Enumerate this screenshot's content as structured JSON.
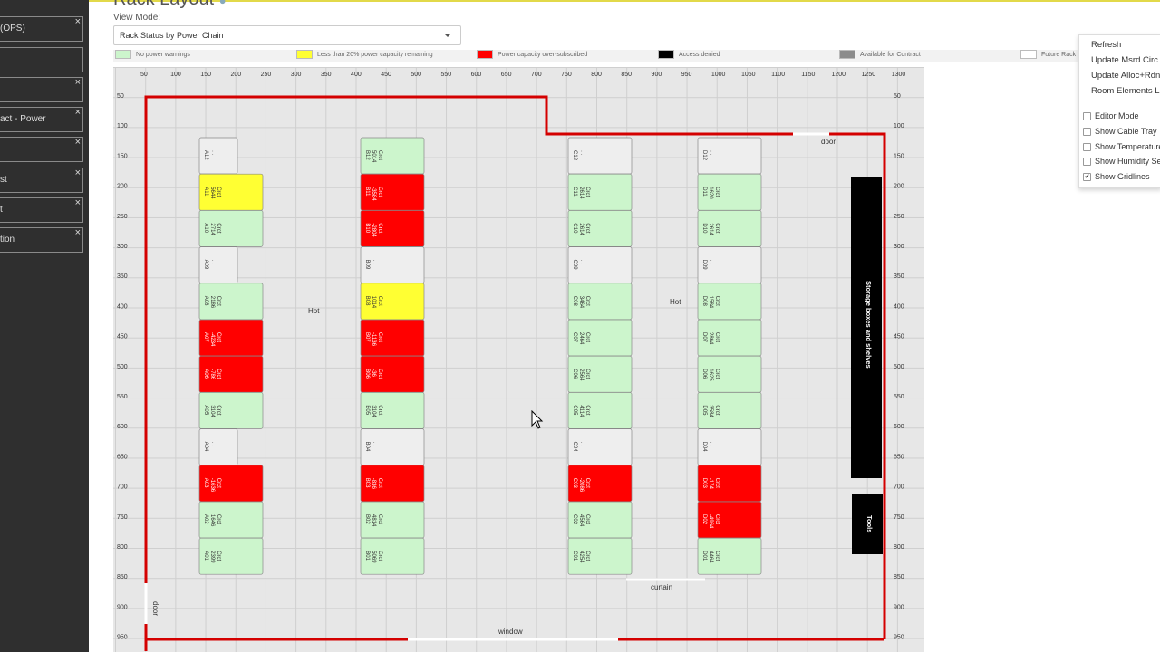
{
  "sidebar": {
    "tabs": [
      {
        "label": "(OPS)",
        "close": "×"
      },
      {
        "label": "",
        "close": ""
      },
      {
        "label": "",
        "close": "×"
      },
      {
        "label": "act - Power",
        "close": "×"
      },
      {
        "label": "",
        "close": "×"
      },
      {
        "label": "st",
        "close": "×"
      },
      {
        "label": "t",
        "close": "×"
      },
      {
        "label": "tion",
        "close": "×"
      }
    ]
  },
  "header": {
    "title": "Rack Layout",
    "view_mode_label": "View Mode:",
    "view_mode_value": "Rack Status by Power Chain"
  },
  "legend": [
    {
      "label": "No power warnings",
      "color": "#ccf5cc"
    },
    {
      "label": "Less than 20% power capacity remaining",
      "color": "#ffff33"
    },
    {
      "label": "Power capacity over-subscribed",
      "color": "#ff0000"
    },
    {
      "label": "Access denied",
      "color": "#000000"
    },
    {
      "label": "Available for Contract",
      "color": "#8c8c8c"
    },
    {
      "label": "Future Rack",
      "color": "#ffffff"
    }
  ],
  "axis": {
    "x_ticks": [
      "50",
      "100",
      "150",
      "200",
      "250",
      "300",
      "350",
      "400",
      "450",
      "500",
      "550",
      "600",
      "650",
      "700",
      "750",
      "800",
      "850",
      "900",
      "950",
      "1000",
      "1050",
      "1100",
      "1150",
      "1200",
      "1250",
      "1300"
    ],
    "y_ticks": [
      "50",
      "100",
      "150",
      "200",
      "250",
      "300",
      "350",
      "400",
      "450",
      "500",
      "550",
      "600",
      "650",
      "700",
      "750",
      "800",
      "850",
      "900",
      "950"
    ]
  },
  "labels": {
    "hot_a": "Hot",
    "hot_b": "Hot",
    "door_top": "door",
    "door_left": "door",
    "curtain": "curtain",
    "window": "window",
    "storage": "Storage boxes and shelves",
    "tools": "Tools"
  },
  "rows": [
    {
      "id": "A",
      "racks": [
        {
          "name": "A12",
          "line1": "",
          "line2": "",
          "status": "empty"
        },
        {
          "name": "A11",
          "line1": "5644",
          "line2": "Crct",
          "status": "warn"
        },
        {
          "name": "A10",
          "line1": "2714",
          "line2": "Crct",
          "status": "ok"
        },
        {
          "name": "A09",
          "line1": "",
          "line2": "",
          "status": "empty"
        },
        {
          "name": "A08",
          "line1": "2186",
          "line2": "Crct",
          "status": "ok"
        },
        {
          "name": "A07",
          "line1": "-4234",
          "line2": "Crct",
          "status": "over"
        },
        {
          "name": "A06",
          "line1": "-786",
          "line2": "Crct",
          "status": "over"
        },
        {
          "name": "A05",
          "line1": "3104",
          "line2": "Crct",
          "status": "ok"
        },
        {
          "name": "A04",
          "line1": "",
          "line2": "",
          "status": "empty"
        },
        {
          "name": "A03",
          "line1": "-1636",
          "line2": "Crct",
          "status": "over"
        },
        {
          "name": "A02",
          "line1": "1646",
          "line2": "Crct",
          "status": "ok"
        },
        {
          "name": "A01",
          "line1": "2399",
          "line2": "Crct",
          "status": "ok"
        }
      ]
    },
    {
      "id": "B",
      "racks": [
        {
          "name": "B12",
          "line1": "5014",
          "line2": "Crct",
          "status": "ok"
        },
        {
          "name": "B11",
          "line1": "-3584",
          "line2": "Crct",
          "status": "over"
        },
        {
          "name": "B10",
          "line1": "-2804",
          "line2": "Crct",
          "status": "over"
        },
        {
          "name": "B09",
          "line1": "",
          "line2": "",
          "status": "empty"
        },
        {
          "name": "B08",
          "line1": "1014",
          "line2": "Crct",
          "status": "warn"
        },
        {
          "name": "B07",
          "line1": "-1136",
          "line2": "Crct",
          "status": "over"
        },
        {
          "name": "B06",
          "line1": "-36",
          "line2": "Crct",
          "status": "over"
        },
        {
          "name": "B05",
          "line1": "3104",
          "line2": "Crct",
          "status": "ok"
        },
        {
          "name": "B04",
          "line1": "",
          "line2": "",
          "status": "empty"
        },
        {
          "name": "B03",
          "line1": "-836",
          "line2": "Crct",
          "status": "over"
        },
        {
          "name": "B02",
          "line1": "4814",
          "line2": "Crct",
          "status": "ok"
        },
        {
          "name": "B01",
          "line1": "5069",
          "line2": "Crct",
          "status": "ok"
        }
      ]
    },
    {
      "id": "C",
      "racks": [
        {
          "name": "C12",
          "line1": "",
          "line2": "",
          "status": "empty"
        },
        {
          "name": "C11",
          "line1": "2614",
          "line2": "Crct",
          "status": "ok"
        },
        {
          "name": "C10",
          "line1": "2614",
          "line2": "Crct",
          "status": "ok"
        },
        {
          "name": "C09",
          "line1": "",
          "line2": "",
          "status": "empty"
        },
        {
          "name": "C08",
          "line1": "3464",
          "line2": "Crct",
          "status": "ok"
        },
        {
          "name": "C07",
          "line1": "2464",
          "line2": "Crct",
          "status": "ok"
        },
        {
          "name": "C06",
          "line1": "2564",
          "line2": "Crct",
          "status": "ok"
        },
        {
          "name": "C05",
          "line1": "4114",
          "line2": "Crct",
          "status": "ok"
        },
        {
          "name": "C04",
          "line1": "",
          "line2": "",
          "status": "empty"
        },
        {
          "name": "C03",
          "line1": "-2086",
          "line2": "Crct",
          "status": "over"
        },
        {
          "name": "C02",
          "line1": "4564",
          "line2": "Crct",
          "status": "ok"
        },
        {
          "name": "C01",
          "line1": "4254",
          "line2": "Crct",
          "status": "ok"
        }
      ]
    },
    {
      "id": "D",
      "racks": [
        {
          "name": "D12",
          "line1": "",
          "line2": "",
          "status": "empty"
        },
        {
          "name": "D11",
          "line1": "1620",
          "line2": "Crct",
          "status": "ok"
        },
        {
          "name": "D10",
          "line1": "2614",
          "line2": "Crct",
          "status": "ok"
        },
        {
          "name": "D09",
          "line1": "",
          "line2": "",
          "status": "empty"
        },
        {
          "name": "D08",
          "line1": "1584",
          "line2": "Crct",
          "status": "ok"
        },
        {
          "name": "D07",
          "line1": "2864",
          "line2": "Crct",
          "status": "ok"
        },
        {
          "name": "D06",
          "line1": "1625",
          "line2": "Crct",
          "status": "ok"
        },
        {
          "name": "D05",
          "line1": "3584",
          "line2": "Crct",
          "status": "ok"
        },
        {
          "name": "D04",
          "line1": "",
          "line2": "",
          "status": "empty"
        },
        {
          "name": "D03",
          "line1": "-174",
          "line2": "Crct",
          "status": "over"
        },
        {
          "name": "D02",
          "line1": "-4964",
          "line2": "Crct",
          "status": "over"
        },
        {
          "name": "D01",
          "line1": "4464",
          "line2": "Crct",
          "status": "ok"
        }
      ]
    }
  ],
  "status_colors": {
    "ok": "#ccf5cc",
    "warn": "#ffff33",
    "over": "#ff0000",
    "empty": "#eeeeee"
  },
  "menu": {
    "items": [
      "Refresh",
      "Update Msrd Circ",
      "Update Alloc+Rdnd",
      "Room Elements Le"
    ],
    "options": [
      {
        "label": "Editor Mode",
        "checked": false
      },
      {
        "label": "Show Cable Tray",
        "checked": false
      },
      {
        "label": "Show Temperature",
        "checked": false
      },
      {
        "label": "Show Humidity Se",
        "checked": false
      },
      {
        "label": "Show Gridlines",
        "checked": true
      }
    ]
  }
}
